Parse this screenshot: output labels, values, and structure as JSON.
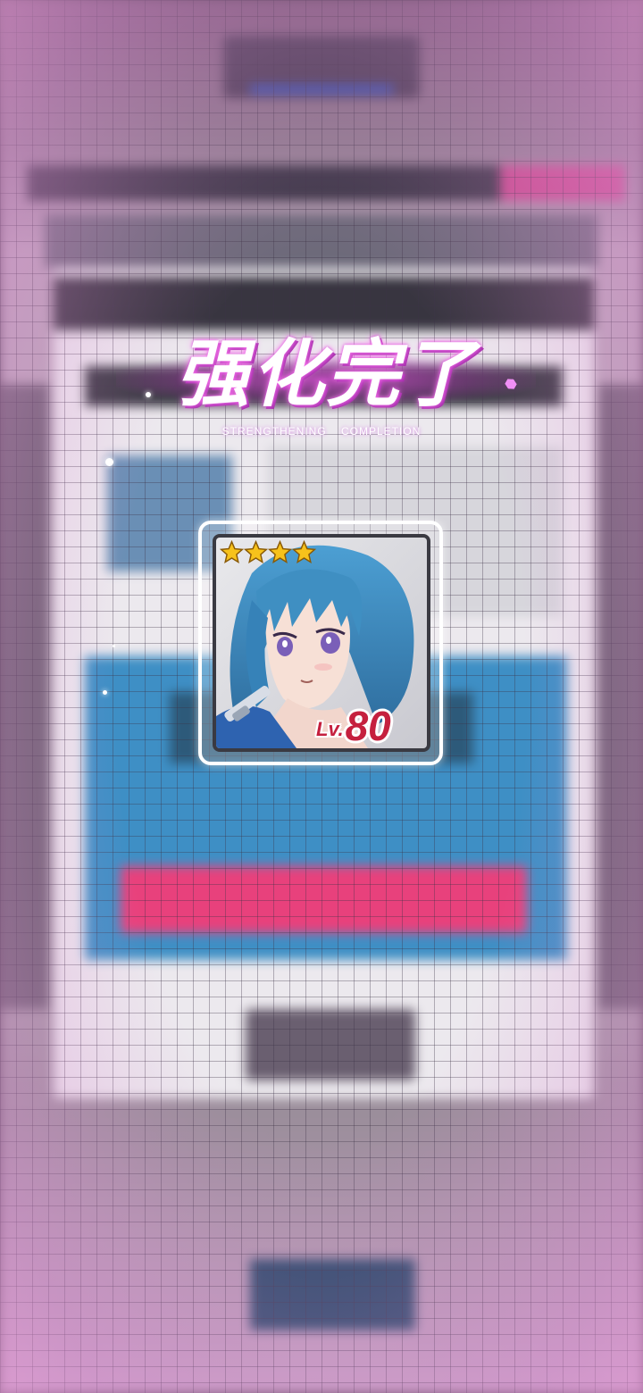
{
  "result": {
    "title": "强化完了",
    "subtitle": "STRENGTHENING COMPLETION"
  },
  "character_card": {
    "rarity_stars": 4,
    "level_prefix": "Lv.",
    "level_value": "80",
    "hair_color": "#3f8fc2",
    "eye_color": "#7a5fb8"
  },
  "colors": {
    "title_glow": "#e050dc",
    "level_red": "#c5203e",
    "star_gold": "#f7c21b"
  }
}
